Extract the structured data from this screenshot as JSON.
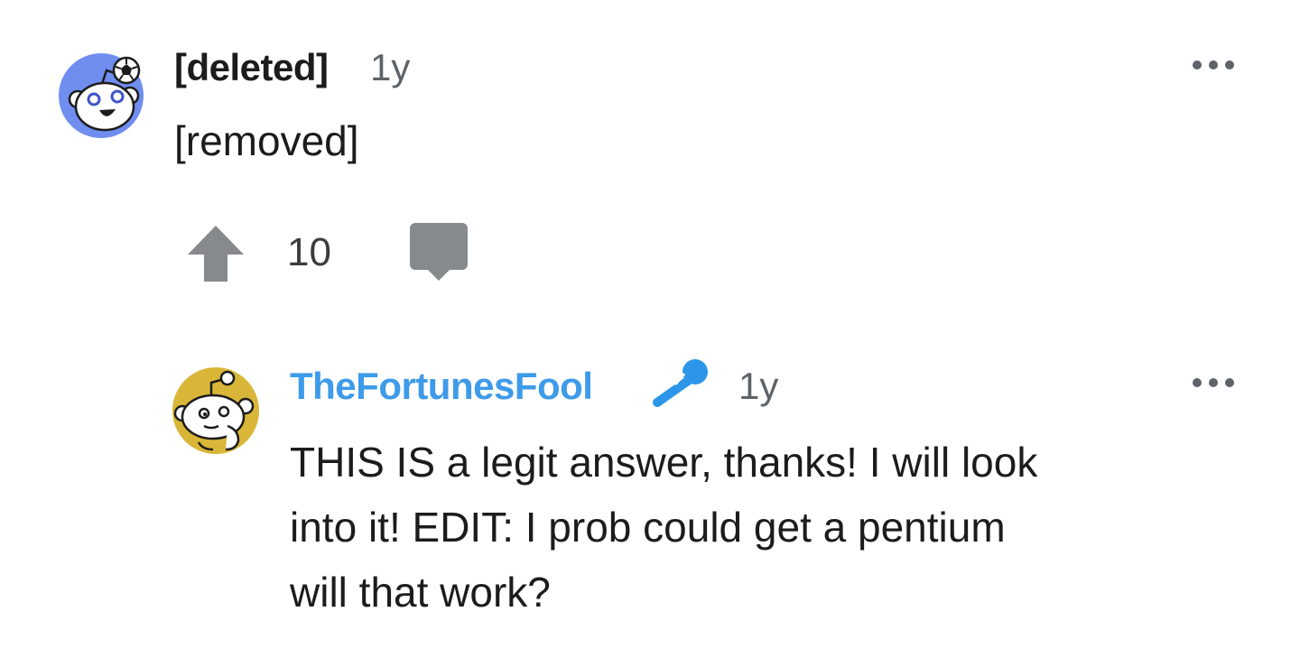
{
  "comments": [
    {
      "author": "[deleted]",
      "age": "1y",
      "body": "[removed]",
      "score": "10",
      "avatar_icon": "snoo-avatar-soccer-icon",
      "avatar_color": "#6f8ef0",
      "actions": {
        "upvote_icon": "upvote-arrow-icon",
        "reply_icon": "comment-bubble-icon",
        "more_icon": "more-dots-icon"
      }
    },
    {
      "author": "TheFortunesFool",
      "author_color": "#3d9be9",
      "flair_icon": "microphone-icon",
      "flair_color": "#2d96e8",
      "age": "1y",
      "body_lines": [
        "THIS IS a legit answer, thanks! I will look",
        "into it! EDIT: I prob could get a pentium",
        "will that work?"
      ],
      "avatar_icon": "snoo-avatar-thinking-icon",
      "avatar_color": "#d9b637",
      "more_icon": "more-dots-icon"
    }
  ]
}
